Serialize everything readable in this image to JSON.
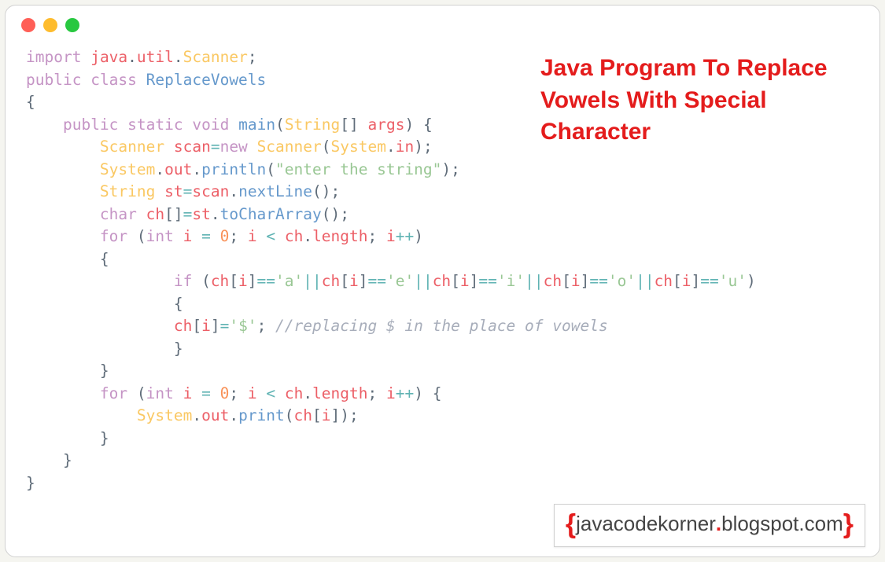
{
  "title_overlay": "Java Program To Replace Vowels With Special Character",
  "watermark": {
    "brace_open": "{",
    "prefix": "javacodekorner",
    "dot": ".",
    "suffix": "blogspot.com",
    "brace_close": "}"
  },
  "code": {
    "line1": {
      "kw1": "import",
      "pkg1": "java",
      "dot1": ".",
      "pkg2": "util",
      "dot2": ".",
      "cls": "Scanner",
      "semi": ";"
    },
    "line2": {
      "kw1": "public",
      "kw2": "class",
      "cls": "ReplaceVowels"
    },
    "line3": {
      "brace": "{"
    },
    "line4": {
      "indent": "    ",
      "kw1": "public",
      "kw2": "static",
      "kw3": "void",
      "fn": "main",
      "paren1": "(",
      "type": "String",
      "brackets": "[]",
      "arg": "args",
      "paren2": ")",
      "brace": " {"
    },
    "line5": {
      "indent": "        ",
      "type": "Scanner",
      "var": "scan",
      "op": "=",
      "kw": "new",
      "ctor": "Scanner",
      "paren1": "(",
      "sys": "System",
      "dot": ".",
      "in": "in",
      "paren2": ")",
      "semi": ";"
    },
    "line6": {
      "indent": "        ",
      "sys": "System",
      "dot1": ".",
      "out": "out",
      "dot2": ".",
      "fn": "println",
      "paren1": "(",
      "str": "\"enter the string\"",
      "paren2": ")",
      "semi": ";"
    },
    "line7": {
      "indent": "        ",
      "type": "String",
      "var": "st",
      "op": "=",
      "scan": "scan",
      "dot": ".",
      "fn": "nextLine",
      "parens": "()",
      "semi": ";"
    },
    "line8": {
      "indent": "        ",
      "type": "char",
      "var": "ch",
      "brackets": "[]",
      "op": "=",
      "st": "st",
      "dot": ".",
      "fn": "toCharArray",
      "parens": "()",
      "semi": ";"
    },
    "line9": {
      "indent": "        ",
      "kw": "for",
      "paren1": " (",
      "type": "int",
      "var": "i",
      "eq": " = ",
      "zero": "0",
      "semi1": ";",
      "cond_l": " i",
      "lt": " < ",
      "ch": "ch",
      "dot": ".",
      "len": "length",
      "semi2": ";",
      "inc": " i",
      "pp": "++",
      "paren2": ")"
    },
    "line10": {
      "indent": "        ",
      "brace": "{"
    },
    "line11": {
      "indent": "                ",
      "kw": "if",
      "paren1": " (",
      "ch1": "ch",
      "br1": "[",
      "i1": "i",
      "br2": "]",
      "eq1": "==",
      "c1": "'a'",
      "or1": "||",
      "ch2": "ch",
      "br3": "[",
      "i2": "i",
      "br4": "]",
      "eq2": "==",
      "c2": "'e'",
      "or2": "||",
      "ch3": "ch",
      "br5": "[",
      "i3": "i",
      "br6": "]",
      "eq3": "==",
      "c3": "'i'",
      "or3": "||",
      "ch4": "ch",
      "br7": "[",
      "i4": "i",
      "br8": "]",
      "eq4": "==",
      "c4": "'o'",
      "or4": "||",
      "ch5": "ch",
      "br9": "[",
      "i5": "i",
      "br10": "]",
      "eq5": "==",
      "c5": "'u'",
      "paren2": ")"
    },
    "line12": {
      "indent": "                ",
      "brace": "{"
    },
    "line13": {
      "indent": "                ",
      "ch": "ch",
      "br1": "[",
      "i": "i",
      "br2": "]",
      "eq": "=",
      "val": "'$'",
      "semi": ";",
      "cmt": " //replacing $ in the place of vowels"
    },
    "line14": {
      "indent": "                ",
      "brace": "}"
    },
    "line15": {
      "indent": "        ",
      "brace": "}"
    },
    "line16": {
      "indent": "        ",
      "kw": "for",
      "paren1": " (",
      "type": "int",
      "var": "i",
      "eq": " = ",
      "zero": "0",
      "semi1": ";",
      "cond_l": " i",
      "lt": " < ",
      "ch": "ch",
      "dot": ".",
      "len": "length",
      "semi2": ";",
      "inc": " i",
      "pp": "++",
      "paren2": ")",
      "brace": " {"
    },
    "line17": {
      "indent": "            ",
      "sys": "System",
      "dot1": ".",
      "out": "out",
      "dot2": ".",
      "fn": "print",
      "paren1": "(",
      "ch": "ch",
      "br1": "[",
      "i": "i",
      "br2": "]",
      "paren2": ")",
      "semi": ";"
    },
    "line18": {
      "indent": "        ",
      "brace": "}"
    },
    "line19": {
      "indent": "    ",
      "brace": "}"
    },
    "line20": {
      "brace": "}"
    }
  }
}
